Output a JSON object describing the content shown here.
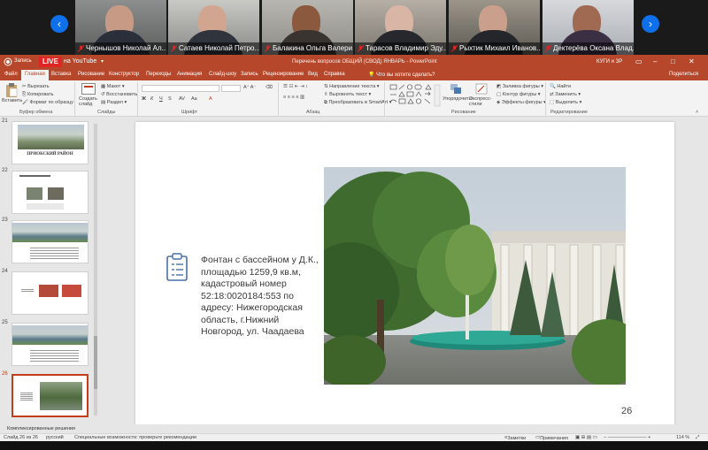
{
  "participants": [
    {
      "name": "Чернышов Николай Ал..."
    },
    {
      "name": "Сатаев Николай Петро..."
    },
    {
      "name": "Балакина Ольга Валери..."
    },
    {
      "name": "Тарасов Владимир Эду..."
    },
    {
      "name": "Рыхтик Михаил Иванов..."
    },
    {
      "name": "Дектерёва Оксана Влад..."
    }
  ],
  "nav": {
    "prev": "‹",
    "next": "›"
  },
  "titlebar": {
    "record": "Запись",
    "live": "LIVE",
    "youtube": "на YouTube",
    "doc_title": "Перечень вопросов ОБЩИЙ (СВОД) ЯНВАРЬ - PowerPoint",
    "user": "КУГИ и ЗР"
  },
  "tabs": [
    "Файл",
    "Главная",
    "Вставка",
    "Рисование",
    "Конструктор",
    "Переходы",
    "Анимация",
    "Слайд-шоу",
    "Запись",
    "Рецензирование",
    "Вид",
    "Справка"
  ],
  "tell_me": "Что вы хотите сделать?",
  "share": "Поделиться",
  "ribbon": {
    "paste": "Вставить",
    "cut": "Вырезать",
    "copy": "Копировать",
    "format_painter": "Формат по образцу",
    "clipboard": "Буфер обмена",
    "new_slide": "Создать слайд",
    "layout": "Макет",
    "reset": "Восстановить",
    "section": "Раздел",
    "slides": "Слайды",
    "font": "Шрифт",
    "text_direction": "Направление текста",
    "align_text": "Выровнять текст",
    "smartart": "Преобразовать в SmartArt",
    "paragraph": "Абзац",
    "arrange": "Упорядочить",
    "quick_styles": "Экспресс-стили",
    "shape_fill": "Заливка фигуры",
    "shape_outline": "Контур фигуры",
    "shape_effects": "Эффекты фигуры",
    "drawing": "Рисование",
    "find": "Найти",
    "replace": "Заменить",
    "select": "Выделить",
    "editing": "Редактирование"
  },
  "thumbs": [
    {
      "num": "21",
      "caption": "ПРИОКСКИЙ РАЙОН"
    },
    {
      "num": "22",
      "caption": ""
    },
    {
      "num": "23",
      "caption": ""
    },
    {
      "num": "24",
      "caption": ""
    },
    {
      "num": "25",
      "caption": ""
    },
    {
      "num": "26",
      "caption": ""
    }
  ],
  "slide": {
    "text": "Фонтан с бассейном у Д.К., площадью 1259,9 кв.м, кадастровый номер 52:18:0020184:553 по адресу: Нижегородская область, г.Нижний Новгород, ул. Чаадаева",
    "page": "26"
  },
  "compo": "Комплексированные решения",
  "status": {
    "slide": "Слайд 26 из 26",
    "lang": "русский",
    "access": "Специальные возможности: проверьте рекомендации",
    "notes": "Заметки",
    "comments": "Примечания",
    "zoom": "114 %"
  },
  "colors": {
    "accent": "#b7472a",
    "active_tab_text": "#b7472a",
    "live": "#e02525",
    "nav": "#0e71eb"
  }
}
